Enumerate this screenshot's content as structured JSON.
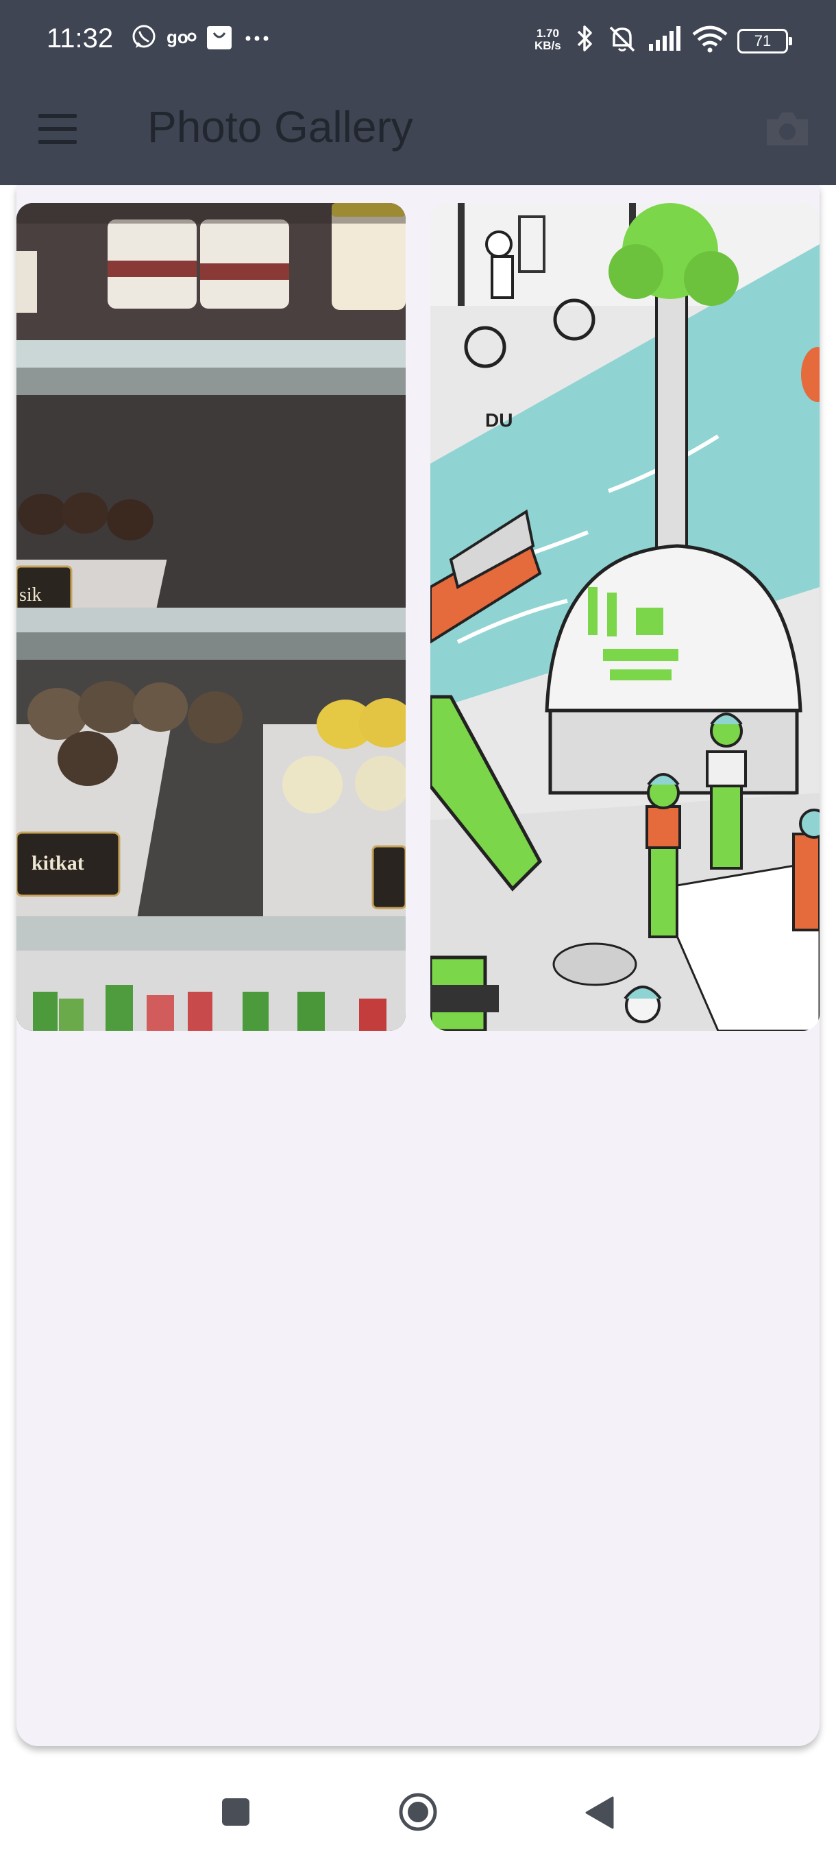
{
  "status_bar": {
    "time": "11:32",
    "net_speed_value": "1.70",
    "net_speed_unit": "KB/s",
    "battery": "71",
    "left_icons": [
      "whatsapp-icon",
      "gojek-icon",
      "shopee-icon",
      "more-dots-icon"
    ],
    "right_icons": [
      "bluetooth-icon",
      "mute-bell-icon",
      "signal-icon",
      "wifi-icon",
      "battery-icon"
    ]
  },
  "app_bar": {
    "title": "Photo Gallery",
    "menu_icon": "hamburger-icon",
    "action_icon": "camera-icon"
  },
  "gallery": {
    "photos": [
      {
        "description": "bakery display case",
        "labels": [
          "sik",
          "kitkat"
        ]
      },
      {
        "description": "illustrated canal street scene",
        "labels": [
          "DU"
        ]
      }
    ]
  },
  "nav_bar": {
    "buttons": [
      "recents-icon",
      "home-icon",
      "back-icon"
    ]
  },
  "colors": {
    "app_bar_bg": "#3f4553",
    "title_text": "#22262e",
    "sheet_bg": "#f4f1f8",
    "canal_teal": "#8fd3d3",
    "illustration_green": "#7cd64a",
    "illustration_orange": "#e56a3c"
  }
}
